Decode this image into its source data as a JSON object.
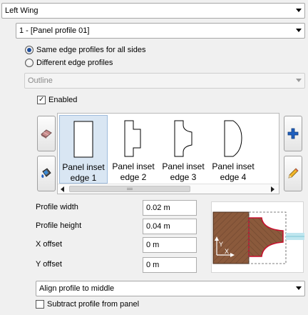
{
  "wing_select": {
    "value": "Left Wing"
  },
  "profile_select": {
    "value": "1 - [Panel profile 01]"
  },
  "edge_mode": {
    "options": [
      {
        "label": "Same edge profiles for all sides",
        "selected": true
      },
      {
        "label": "Different edge profiles",
        "selected": false
      }
    ]
  },
  "outline_select": {
    "value": "Outline",
    "disabled": true
  },
  "enabled": {
    "label": "Enabled",
    "checked": true
  },
  "left_buttons": {
    "top_icon": "eraser-icon",
    "bottom_icon": "paint-bucket-icon"
  },
  "right_buttons": {
    "top_icon": "add-icon",
    "bottom_icon": "pencil-icon"
  },
  "profiles": [
    {
      "line1": "Panel inset",
      "line2": "edge 1",
      "selected": true
    },
    {
      "line1": "Panel inset",
      "line2": "edge 2",
      "selected": false
    },
    {
      "line1": "Panel inset",
      "line2": "edge 3",
      "selected": false
    },
    {
      "line1": "Panel inset",
      "line2": "edge 4",
      "selected": false
    }
  ],
  "fields": {
    "width": {
      "label": "Profile width",
      "value": "0.02 m"
    },
    "height": {
      "label": "Profile height",
      "value": "0.04 m"
    },
    "x_offset": {
      "label": "X offset",
      "value": "0 m"
    },
    "y_offset": {
      "label": "Y offset",
      "value": "0 m"
    }
  },
  "preview": {
    "x_axis": "X",
    "y_axis": "Y"
  },
  "align_select": {
    "value": "Align profile to middle"
  },
  "subtract": {
    "label": "Subtract profile from panel",
    "checked": false
  },
  "colors": {
    "wood": "#8b5a3c",
    "profile_outline": "#c8102e",
    "selection": "#d9e6f3",
    "accent_blue": "#1f5fbf"
  }
}
